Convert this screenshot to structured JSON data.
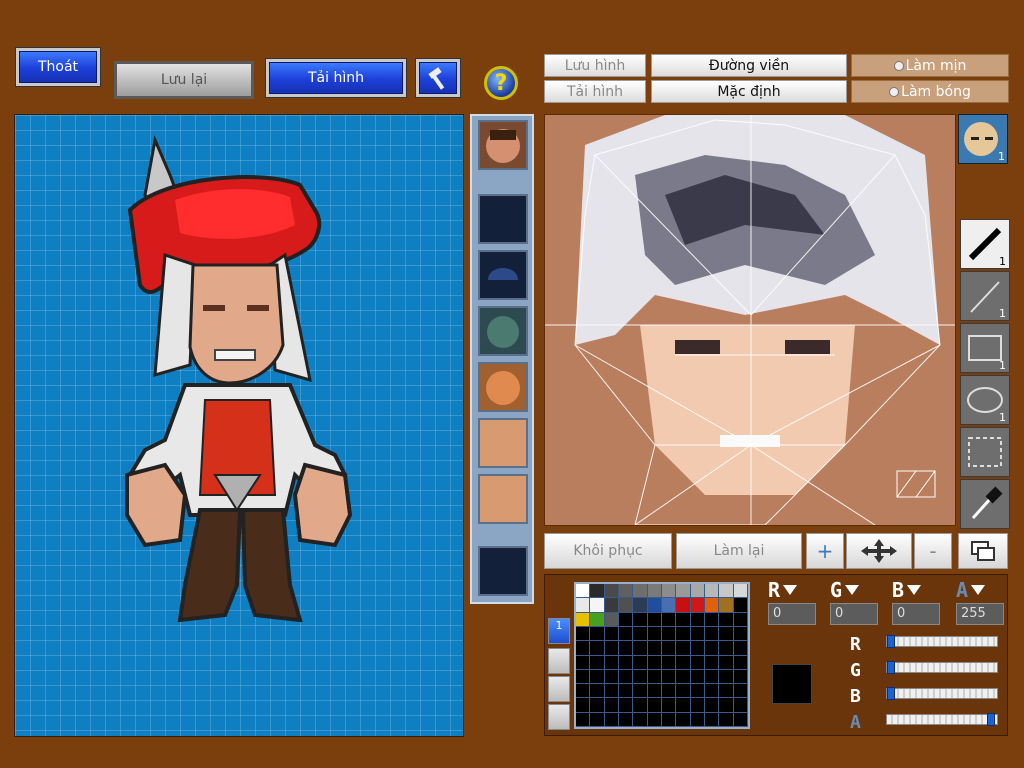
{
  "top_left": {
    "exit_label": "Thoát",
    "save_label": "Lưu lại",
    "load_label": "Tải hình",
    "help_label": "?"
  },
  "top_right": {
    "save_image_label": "Lưu hình",
    "load_image_label": "Tải hình",
    "outline_label": "Đường viền",
    "default_label": "Mặc định",
    "smooth_label": "Làm mịn",
    "shade_label": "Làm bóng"
  },
  "face_thumb_badge": "1",
  "tools": [
    {
      "name": "pen-tool",
      "count": "1"
    },
    {
      "name": "line-tool",
      "count": "1"
    },
    {
      "name": "rectangle-tool",
      "count": "1"
    },
    {
      "name": "ellipse-tool",
      "count": "1"
    },
    {
      "name": "selection-tool",
      "count": ""
    },
    {
      "name": "eyedropper-tool",
      "count": ""
    }
  ],
  "bottom_bar": {
    "restore_label": "Khôi phục",
    "redo_label": "Làm lại",
    "zoom_in_label": "+",
    "zoom_out_label": "-"
  },
  "palette_tab_label": "1",
  "color_values": {
    "r": "0",
    "g": "0",
    "b": "0",
    "a": "255"
  },
  "sliders": {
    "r": 0,
    "g": 0,
    "b": 0,
    "a": 1.0
  },
  "palette_colors": [
    "#ffffff",
    "#2a2a2a",
    "#4a4a4a",
    "#606060",
    "#6e6e6e",
    "#7a7a7a",
    "#8c8c8c",
    "#9a9a9a",
    "#a8a8a8",
    "#b8b8b8",
    "#c8c8c8",
    "#d8d8d8",
    "#e8e8e8",
    "#f5f5f5",
    "#3a3a3a",
    "#505050",
    "#2c3c58",
    "#1f4f9c",
    "#4a6fb0",
    "#c81010",
    "#d01818",
    "#e06010",
    "#a07020",
    "#000000",
    "#e8c000",
    "#48a020",
    "#5a5a5a"
  ],
  "current_color": "#000000"
}
